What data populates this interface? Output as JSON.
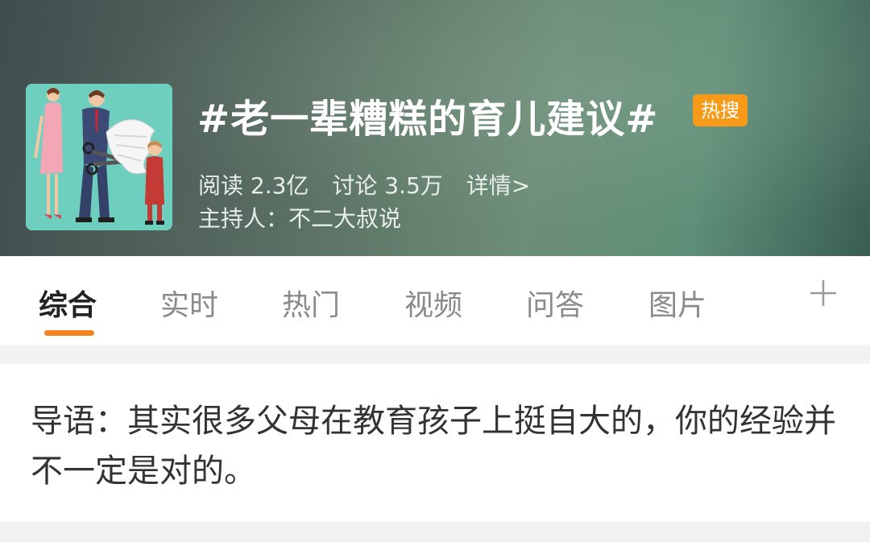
{
  "header": {
    "title": "#老一辈糟糕的育儿建议#",
    "badge": "热搜",
    "stats": {
      "reads": "阅读 2.3亿",
      "discussions": "讨论 3.5万",
      "details": "详情>"
    },
    "host": "主持人：不二大叔说"
  },
  "tabs": [
    {
      "label": "综合",
      "active": true
    },
    {
      "label": "实时",
      "active": false
    },
    {
      "label": "热门",
      "active": false
    },
    {
      "label": "视频",
      "active": false
    },
    {
      "label": "问答",
      "active": false
    },
    {
      "label": "图片",
      "active": false
    }
  ],
  "tab_add_icon": "plus-icon",
  "intro": {
    "text": "导语：其实很多父母在教育孩子上挺自大的，你的经验并不一定是对的。"
  },
  "colors": {
    "accent": "#f5841f",
    "badge": "#f79a1a",
    "cover_bg": "#6fcfbf"
  }
}
